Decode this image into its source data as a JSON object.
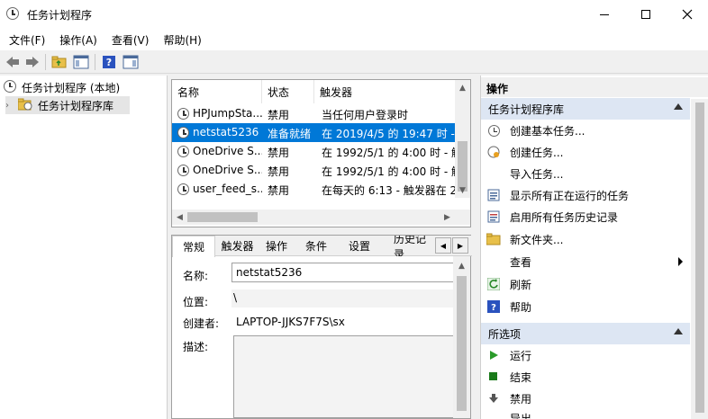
{
  "window": {
    "title": "任务计划程序"
  },
  "menu": [
    "文件(F)",
    "操作(A)",
    "查看(V)",
    "帮助(H)"
  ],
  "tree": {
    "root": "任务计划程序 (本地)",
    "child": "任务计划程序库"
  },
  "columns": [
    "名称",
    "状态",
    "触发器"
  ],
  "tasks": [
    {
      "name": "HPJumpSta...",
      "status": "禁用",
      "trigger": "当任何用户登录时"
    },
    {
      "name": "netstat5236",
      "status": "准备就绪",
      "trigger": "在 2019/4/5 的 19:47 时 -"
    },
    {
      "name": "OneDrive S...",
      "status": "禁用",
      "trigger": "在 1992/5/1 的 4:00 时 - 触"
    },
    {
      "name": "OneDrive S...",
      "status": "禁用",
      "trigger": "在 1992/5/1 的 4:00 时 - 触"
    },
    {
      "name": "user_feed_s...",
      "status": "禁用",
      "trigger": "在每天的 6:13 - 触发器在 2"
    }
  ],
  "tabs": [
    "常规",
    "触发器",
    "操作",
    "条件",
    "设置",
    "历史记录"
  ],
  "detail": {
    "name_label": "名称:",
    "name_value": "netstat5236",
    "location_label": "位置:",
    "location_value": "\\",
    "author_label": "创建者:",
    "author_value": "LAPTOP-JJKS7F7S\\sx",
    "desc_label": "描述:"
  },
  "actions": {
    "header": "操作",
    "section1": "任务计划程序库",
    "items1": [
      "创建基本任务...",
      "创建任务...",
      "导入任务...",
      "显示所有正在运行的任务",
      "启用所有任务历史记录",
      "新文件夹...",
      "查看",
      "刷新",
      "帮助"
    ],
    "section2": "所选项",
    "items2": [
      "运行",
      "结束",
      "禁用",
      "导出..."
    ]
  },
  "icons": {
    "app": "clock-icon",
    "folder": "folder-icon",
    "refresh": "refresh-icon",
    "help": "help-icon",
    "run": "run-icon",
    "stop": "stop-icon",
    "disable": "disable-icon"
  },
  "colors": {
    "selection": "#0078d7",
    "section_bg": "#dde6f3",
    "help_blue": "#2a52be"
  }
}
